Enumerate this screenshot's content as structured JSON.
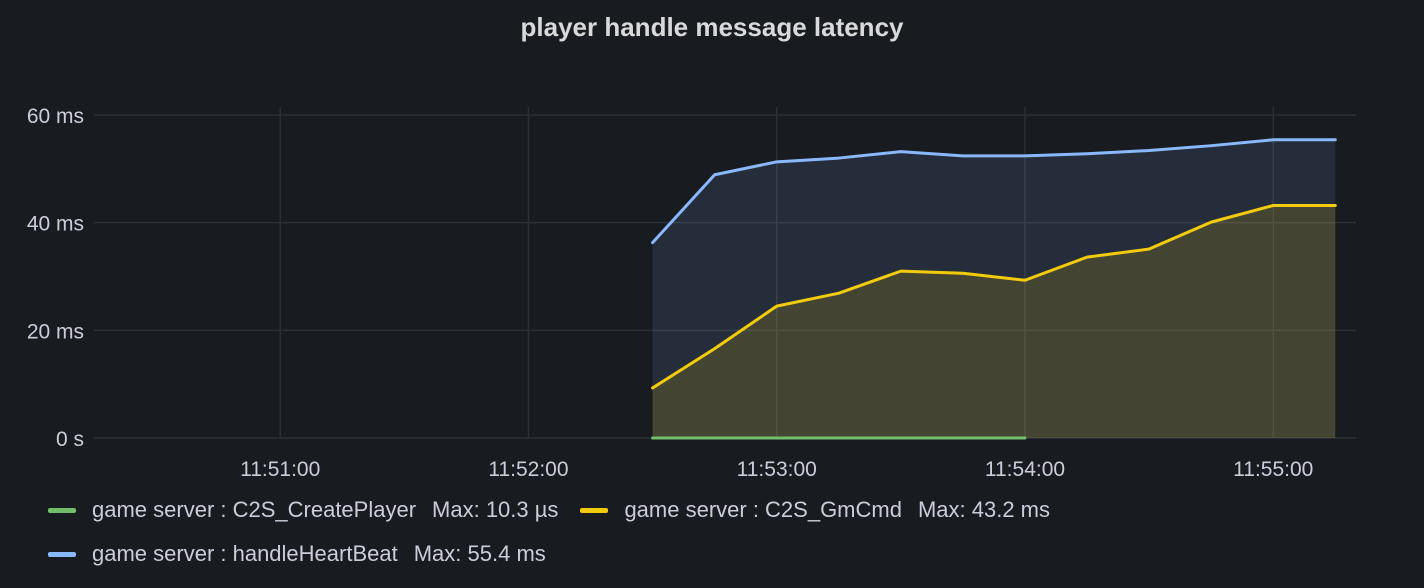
{
  "panel": {
    "title": "player handle message latency"
  },
  "chart_data": {
    "type": "area",
    "title": "player handle message latency",
    "xlabel": "",
    "ylabel": "",
    "x_ticks": [
      "11:51:00",
      "11:52:00",
      "11:53:00",
      "11:54:00",
      "11:55:00"
    ],
    "y_ticks": [
      {
        "value": 0,
        "label": "0 s"
      },
      {
        "value": 20,
        "label": "20 ms"
      },
      {
        "value": 40,
        "label": "40 ms"
      },
      {
        "value": 60,
        "label": "60 ms"
      }
    ],
    "xlim": [
      "11:50:15",
      "11:55:20"
    ],
    "ylim": [
      0,
      60
    ],
    "grid": true,
    "legend_placement": "bottom",
    "series": [
      {
        "name": "game server : C2S_CreatePlayer",
        "color": "#73bf69",
        "max_label": "Max: 10.3 µs",
        "fill": false,
        "times": [
          "11:52:30",
          "11:54:00"
        ],
        "values": [
          0.01,
          0.01
        ]
      },
      {
        "name": "game server : C2S_GmCmd",
        "color": "#f2cc0c",
        "max_label": "Max: 43.2 ms",
        "fill": true,
        "times": [
          "11:52:30",
          "11:52:45",
          "11:53:00",
          "11:53:15",
          "11:53:30",
          "11:53:45",
          "11:54:00",
          "11:54:15",
          "11:54:30",
          "11:54:45",
          "11:55:00",
          "11:55:15"
        ],
        "values": [
          9.3,
          16.6,
          24.5,
          26.9,
          31.0,
          30.6,
          29.3,
          33.6,
          35.1,
          40.1,
          43.2,
          43.2
        ]
      },
      {
        "name": "game server : handleHeartBeat",
        "color": "#8ab8ff",
        "max_label": "Max: 55.4 ms",
        "fill": true,
        "times": [
          "11:52:30",
          "11:52:45",
          "11:53:00",
          "11:53:15",
          "11:53:30",
          "11:53:45",
          "11:54:00",
          "11:54:15",
          "11:54:30",
          "11:54:45",
          "11:55:00",
          "11:55:15"
        ],
        "values": [
          36.3,
          48.9,
          51.3,
          52.0,
          53.2,
          52.4,
          52.4,
          52.8,
          53.4,
          54.3,
          55.4,
          55.4
        ]
      }
    ]
  }
}
